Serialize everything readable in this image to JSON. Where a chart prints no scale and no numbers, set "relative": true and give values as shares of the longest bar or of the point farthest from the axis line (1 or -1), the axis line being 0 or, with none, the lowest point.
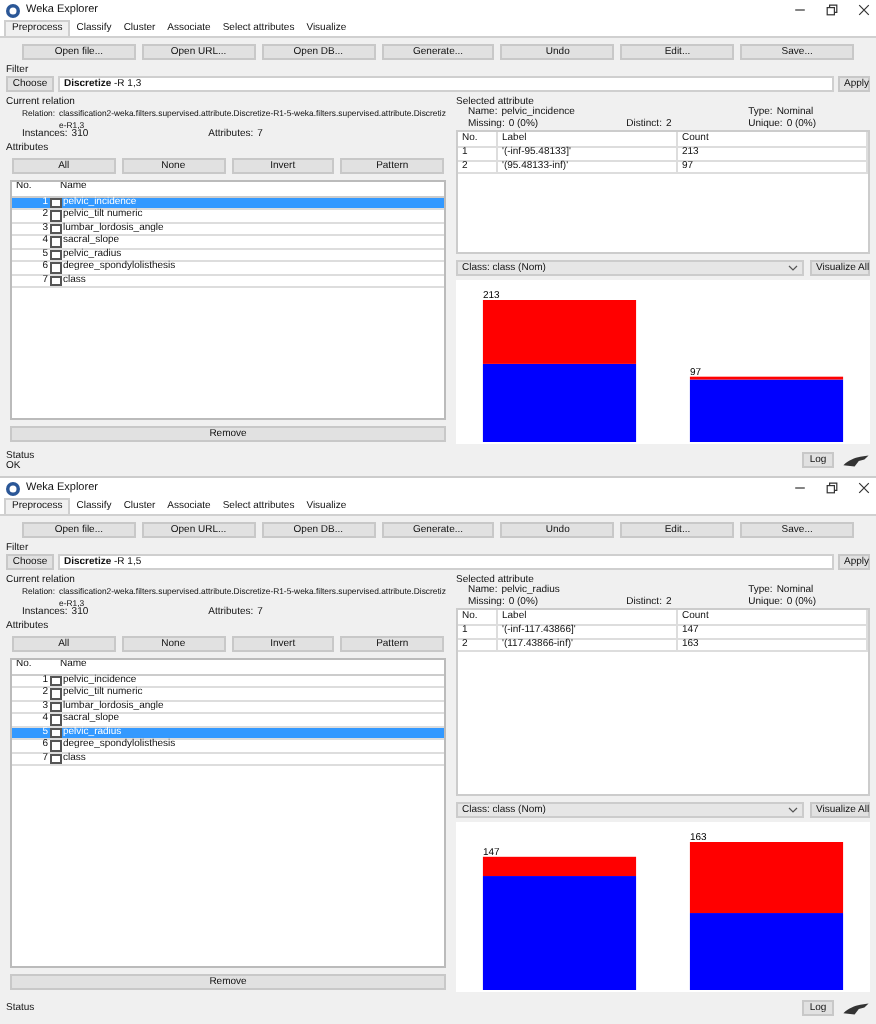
{
  "windows": [
    {
      "title": "Weka Explorer",
      "tabs": [
        {
          "label": "Preprocess",
          "selected": true
        },
        {
          "label": "Classify",
          "selected": false
        },
        {
          "label": "Cluster",
          "selected": false
        },
        {
          "label": "Associate",
          "selected": false
        },
        {
          "label": "Select attributes",
          "selected": false
        },
        {
          "label": "Visualize",
          "selected": false
        }
      ],
      "buttons": [
        "Open file...",
        "Open URL...",
        "Open DB...",
        "Generate...",
        "Undo",
        "Edit...",
        "Save..."
      ],
      "filter": {
        "heading": "Filter",
        "choose": "Choose",
        "value": "Discretize -R 1,3",
        "apply": "Apply"
      },
      "current_relation": {
        "heading": "Current relation",
        "relation_label": "Relation:",
        "relation": "classification2-weka.filters.supervised.attribute.Discretize-R1-5-weka.filters.supervised.attribute.Discretize-R1,3",
        "instances_label": "Instances:",
        "instances": "310",
        "attributes_label": "Attributes:",
        "attributes": "7"
      },
      "attributes": {
        "heading": "Attributes",
        "buttons": [
          "All",
          "None",
          "Invert",
          "Pattern"
        ],
        "columns": [
          "No.",
          "Name"
        ],
        "rows": [
          {
            "no": "1",
            "name": "pelvic_incidence",
            "checked": false,
            "selected": true
          },
          {
            "no": "2",
            "name": "pelvic_tilt numeric",
            "checked": false,
            "selected": false
          },
          {
            "no": "3",
            "name": "lumbar_lordosis_angle",
            "checked": false,
            "selected": false
          },
          {
            "no": "4",
            "name": "sacral_slope",
            "checked": false,
            "selected": false
          },
          {
            "no": "5",
            "name": "pelvic_radius",
            "checked": false,
            "selected": false
          },
          {
            "no": "6",
            "name": "degree_spondylolisthesis",
            "checked": false,
            "selected": false
          },
          {
            "no": "7",
            "name": "class",
            "checked": false,
            "selected": false
          }
        ],
        "remove": "Remove"
      },
      "selected_attribute": {
        "heading": "Selected attribute",
        "name_label": "Name:",
        "name": "pelvic_incidence",
        "missing_label": "Missing:",
        "missing": "0 (0%)",
        "distinct_label": "Distinct:",
        "distinct": "2",
        "type_label": "Type:",
        "type": "Nominal",
        "unique_label": "Unique:",
        "unique": "0 (0%)",
        "columns": [
          "No.",
          "Label",
          "Count"
        ],
        "rows": [
          {
            "no": "1",
            "label": "'(-inf-95.48133]'",
            "count": "213"
          },
          {
            "no": "2",
            "label": "'(95.48133-inf)'",
            "count": "97"
          }
        ]
      },
      "class_view": {
        "value": "Class: class (Nom)",
        "button": "Visualize All",
        "bar_counts": [
          "213",
          "97"
        ],
        "chart_data": {
          "type": "bar",
          "stacked": true,
          "relative": true,
          "series": [
            {
              "color": "#0000ff",
              "values": [
                0.55,
                0.44
              ]
            },
            {
              "color": "#ff0000",
              "values": [
                0.45,
                0.02
              ]
            }
          ]
        }
      },
      "status": {
        "heading": "Status",
        "text": "OK",
        "log": "Log"
      }
    },
    {
      "title": "Weka Explorer",
      "tabs": [
        {
          "label": "Preprocess",
          "selected": true
        },
        {
          "label": "Classify",
          "selected": false
        },
        {
          "label": "Cluster",
          "selected": false
        },
        {
          "label": "Associate",
          "selected": false
        },
        {
          "label": "Select attributes",
          "selected": false
        },
        {
          "label": "Visualize",
          "selected": false
        }
      ],
      "buttons": [
        "Open file...",
        "Open URL...",
        "Open DB...",
        "Generate...",
        "Undo",
        "Edit...",
        "Save..."
      ],
      "filter": {
        "heading": "Filter",
        "choose": "Choose",
        "value": "Discretize -R 1,5",
        "apply": "Apply"
      },
      "current_relation": {
        "heading": "Current relation",
        "relation_label": "Relation:",
        "relation": "classification2-weka.filters.supervised.attribute.Discretize-R1-5-weka.filters.supervised.attribute.Discretize-R1,3",
        "instances_label": "Instances:",
        "instances": "310",
        "attributes_label": "Attributes:",
        "attributes": "7"
      },
      "attributes": {
        "heading": "Attributes",
        "buttons": [
          "All",
          "None",
          "Invert",
          "Pattern"
        ],
        "columns": [
          "No.",
          "Name"
        ],
        "rows": [
          {
            "no": "1",
            "name": "pelvic_incidence",
            "checked": false,
            "selected": false
          },
          {
            "no": "2",
            "name": "pelvic_tilt numeric",
            "checked": false,
            "selected": false
          },
          {
            "no": "3",
            "name": "lumbar_lordosis_angle",
            "checked": false,
            "selected": false
          },
          {
            "no": "4",
            "name": "sacral_slope",
            "checked": false,
            "selected": false
          },
          {
            "no": "5",
            "name": "pelvic_radius",
            "checked": false,
            "selected": true
          },
          {
            "no": "6",
            "name": "degree_spondylolisthesis",
            "checked": false,
            "selected": false
          },
          {
            "no": "7",
            "name": "class",
            "checked": false,
            "selected": false
          }
        ],
        "remove": "Remove"
      },
      "selected_attribute": {
        "heading": "Selected attribute",
        "name_label": "Name:",
        "name": "pelvic_radius",
        "missing_label": "Missing:",
        "missing": "0 (0%)",
        "distinct_label": "Distinct:",
        "distinct": "2",
        "type_label": "Type:",
        "type": "Nominal",
        "unique_label": "Unique:",
        "unique": "0 (0%)",
        "columns": [
          "No.",
          "Label",
          "Count"
        ],
        "rows": [
          {
            "no": "1",
            "label": "'(-inf-117.43866]'",
            "count": "147"
          },
          {
            "no": "2",
            "label": "'(117.43866-inf)'",
            "count": "163"
          }
        ]
      },
      "class_view": {
        "value": "Class: class (Nom)",
        "button": "Visualize All",
        "bar_counts": [
          "147",
          "163"
        ],
        "chart_data": {
          "type": "bar",
          "stacked": true,
          "relative": true,
          "series": [
            {
              "color": "#0000ff",
              "values": [
                0.77,
                0.52
              ]
            },
            {
              "color": "#ff0000",
              "values": [
                0.13,
                0.48
              ]
            }
          ]
        }
      },
      "status": {
        "heading": "Status",
        "log": "Log"
      }
    }
  ]
}
